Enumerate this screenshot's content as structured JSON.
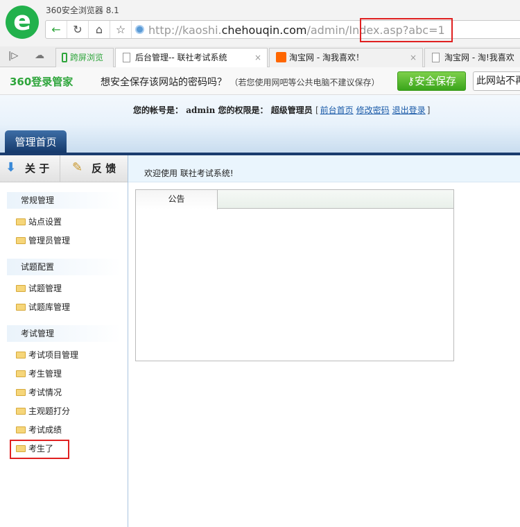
{
  "browser": {
    "title": "360安全浏览器 8.1",
    "logo": "e",
    "url_gray_prefix": "http://kaoshi.",
    "url_domain": "chehouqin.com",
    "url_path": "/admin/Index.asp?abc=1",
    "tabs": [
      {
        "label": "跨屏浏览"
      },
      {
        "label": "后台管理-- 联社考试系统",
        "active": true
      },
      {
        "label": "淘宝网 - 淘我喜欢！"
      },
      {
        "label": "淘宝网 - 淘!我喜欢"
      }
    ],
    "close_glyph": "×"
  },
  "login_bar": {
    "brand": "360登录管家",
    "question": "想安全保存该网站的密码吗？",
    "note": "（若您使用网吧等公共电脑不建议保存）",
    "save_button": "安全保存",
    "nosave_button": "此网站不再提示"
  },
  "header": {
    "account_label": "您的帐号是：",
    "account": "admin",
    "role_label": "您的权限是：",
    "role": "超级管理员",
    "bracket_open": "[",
    "bracket_close": "]",
    "links": [
      "前台首页",
      "修改密码",
      "退出登录"
    ],
    "main_tab": "管理首页"
  },
  "sidebar": {
    "about": "关 于",
    "feedback": "反 馈",
    "sections": [
      {
        "title": "常规管理",
        "items": [
          "站点设置",
          "管理员管理"
        ]
      },
      {
        "title": "试题配置",
        "items": [
          "试题管理",
          "试题库管理"
        ]
      },
      {
        "title": "考试管理",
        "items": [
          "考试项目管理",
          "考生管理",
          "考试情况",
          "主观题打分",
          "考试成绩",
          "考生了"
        ]
      }
    ]
  },
  "main": {
    "welcome": "欢迎使用 联社考试系统!",
    "panel_tab": "公告"
  },
  "colors": {
    "highlight": "#e02020",
    "nav": "#1a3c6e",
    "link": "#1a5aa8"
  }
}
